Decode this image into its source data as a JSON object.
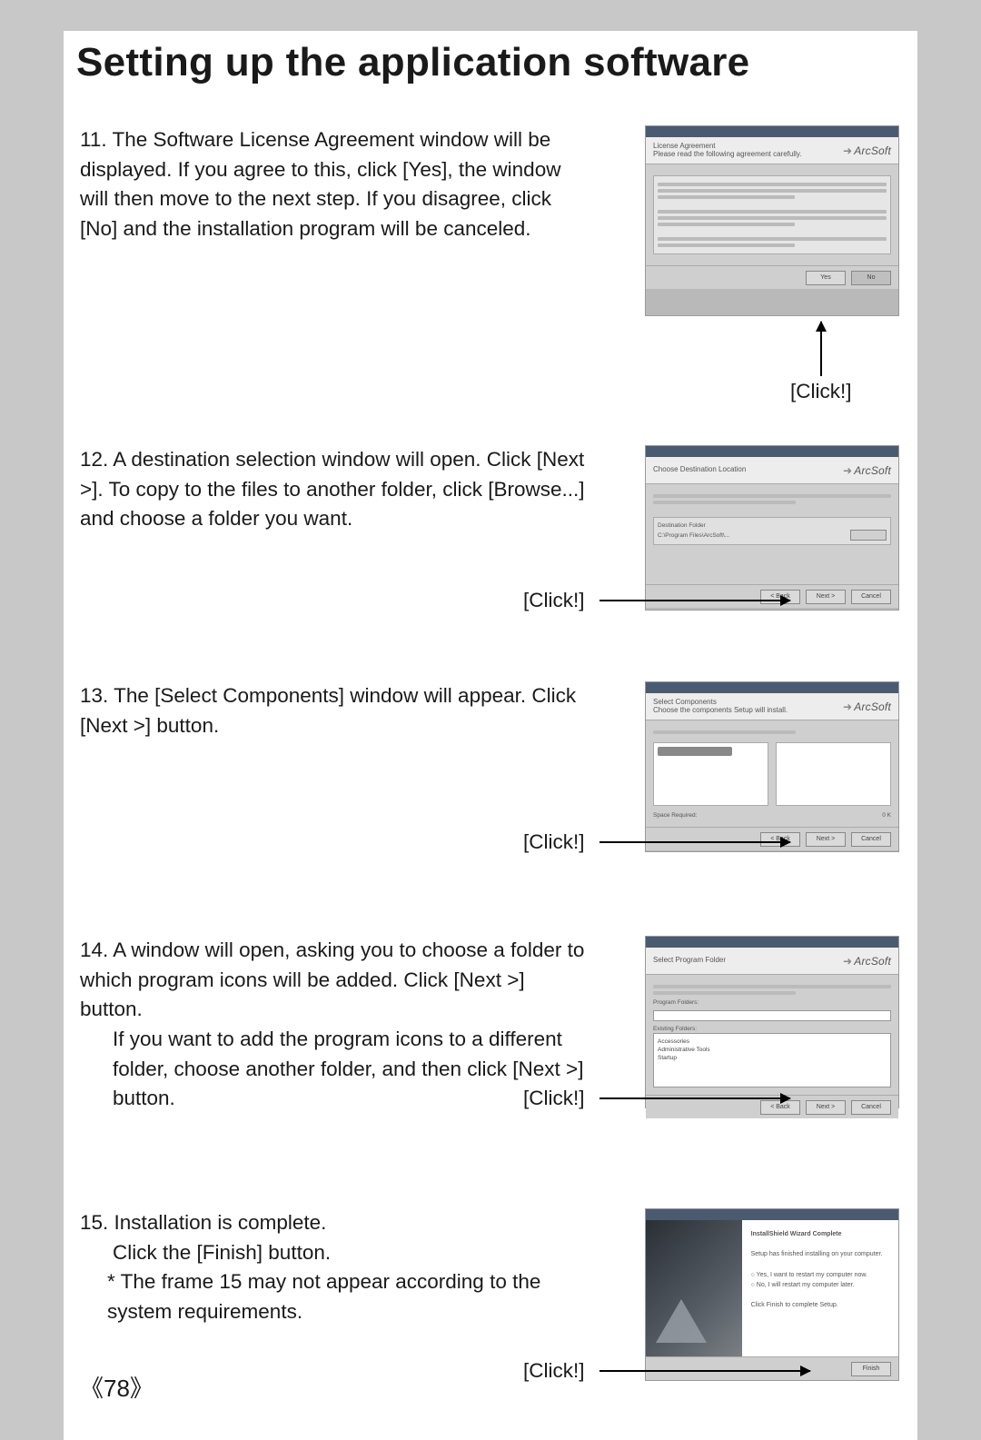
{
  "title": "Setting up the application software",
  "page_number": "78",
  "page_number_display": "《78》",
  "click_label": "[Click!]",
  "brand": "ArcSoft",
  "steps": {
    "s11": {
      "num": "11.",
      "text": "The Software License Agreement window will be displayed. If you agree to this, click [Yes], the window will then move to the next step. If you disagree, click [No] and the installation program will be canceled."
    },
    "s12": {
      "num": "12.",
      "text": "A destination selection window will open. Click [Next >]. To copy to the files to another folder, click [Browse...] and choose a folder you want."
    },
    "s13": {
      "num": "13.",
      "text": "The [Select Components] window will appear. Click [Next >] button."
    },
    "s14": {
      "num": "14.",
      "text_a": "A window will open, asking you to choose a folder to which program icons will be added. Click [Next >] button.",
      "text_b": "If you want to add the program icons to a different folder, choose another folder, and then click [Next >] button."
    },
    "s15": {
      "num": "15.",
      "text_a": "Installation is complete.",
      "text_b": "Click the [Finish] button.",
      "note": "* The frame 15 may not appear according to the system requirements."
    }
  },
  "shots": {
    "license": {
      "buttons": [
        "Yes",
        "No"
      ]
    },
    "dest": {
      "buttons": [
        "< Back",
        "Next >",
        "Cancel"
      ]
    },
    "comp": {
      "buttons": [
        "< Back",
        "Next >",
        "Cancel"
      ]
    },
    "folder": {
      "buttons": [
        "< Back",
        "Next >",
        "Cancel"
      ]
    },
    "finish": {
      "buttons": [
        "Finish"
      ]
    }
  }
}
